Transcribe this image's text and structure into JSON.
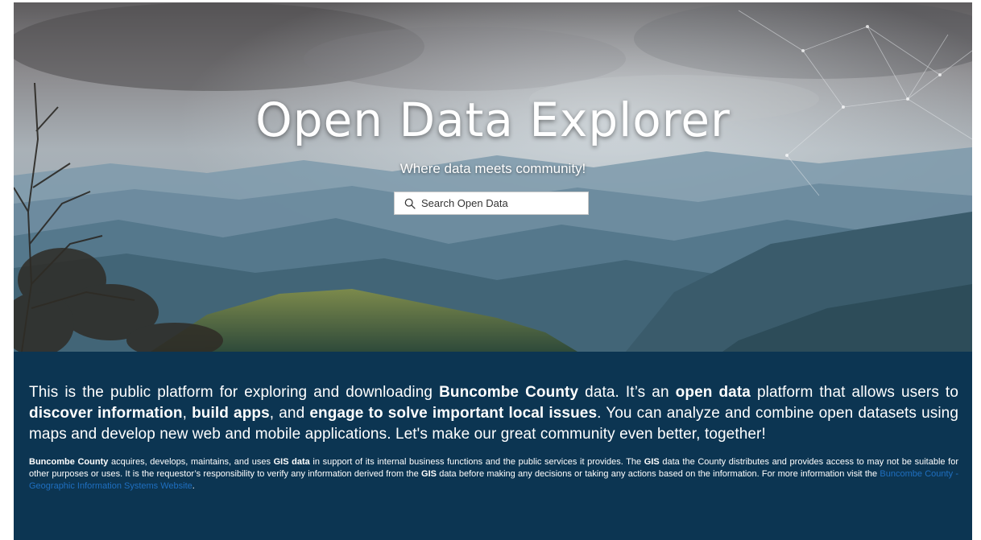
{
  "hero": {
    "title": "Open Data Explorer",
    "subtitle": "Where data meets community!",
    "search": {
      "placeholder": "Search Open Data",
      "icon": "search-icon"
    }
  },
  "intro": {
    "p1": "This is the public platform for exploring and downloading ",
    "b1": "Buncombe County",
    "p2": " data. It’s an ",
    "b2": "open data",
    "p3": " platform that allows users to ",
    "b3": "discover information",
    "p4": ", ",
    "b4": "build apps",
    "p5": ", and ",
    "b5": "engage to solve important local issues",
    "p6": ". You can analyze and combine open datasets using maps and develop new web and mobile applications. Let's make our great community even better, together!"
  },
  "disclaimer": {
    "b1": "Buncombe County",
    "p1": " acquires, develops, maintains, and uses ",
    "b2": "GIS data",
    "p2": " in support of its internal business functions and the public services it provides. The ",
    "b3": "GIS",
    "p3": " data the County distributes and provides access to may not be suitable for other purposes or uses. It is the requestor’s responsibility to verify any information derived from the ",
    "b4": "GIS",
    "p4": " data before making any decisions or taking any actions based on the information. For more information visit the ",
    "link": "Buncombe County - Geographic Information Systems Website",
    "p5": "."
  },
  "colors": {
    "panel_bg": "#0c3552",
    "link": "#1f6fc0",
    "text": "#ffffff"
  }
}
